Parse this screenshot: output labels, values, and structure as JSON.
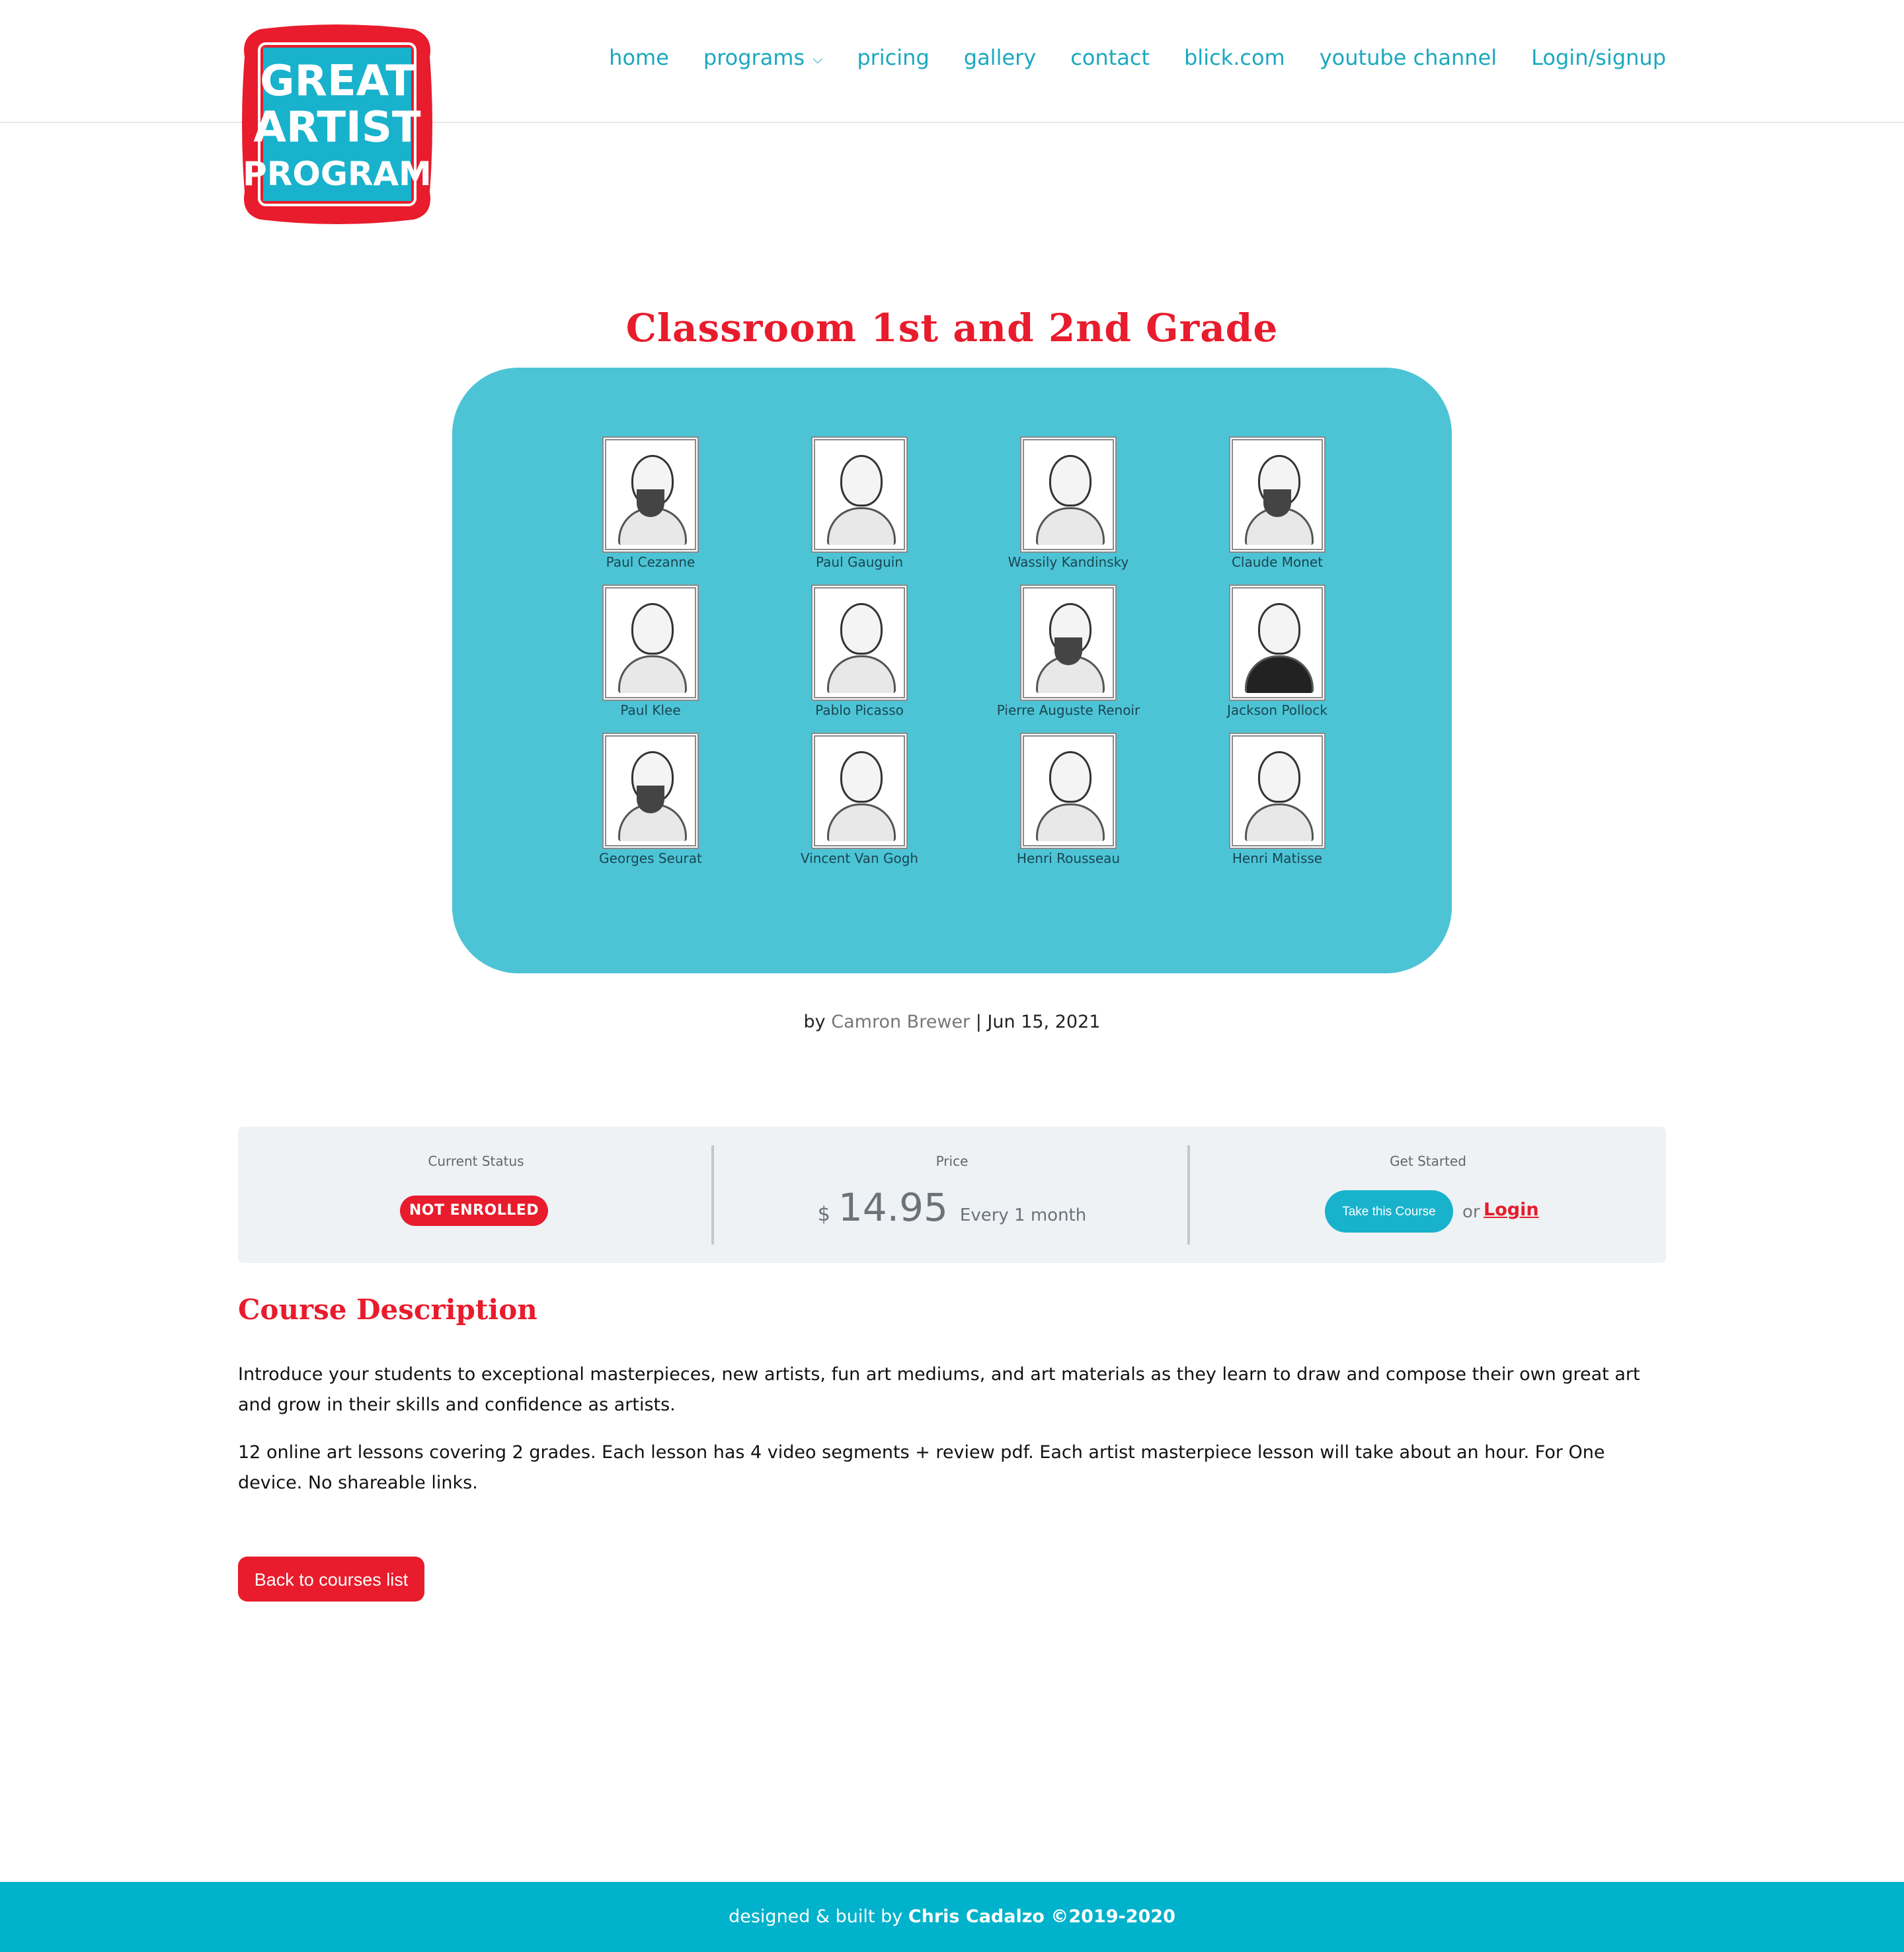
{
  "brand": {
    "logo_lines": [
      "GREAT",
      "ARTIST",
      "PROGRAM"
    ],
    "colors": {
      "red": "#e81c2c",
      "teal": "#18b2cc",
      "hero": "#4cc4d6"
    }
  },
  "nav": {
    "items": [
      {
        "label": "home"
      },
      {
        "label": "programs",
        "icon": "chevron-down-icon"
      },
      {
        "label": "pricing"
      },
      {
        "label": "gallery"
      },
      {
        "label": "contact"
      },
      {
        "label": "blick.com"
      },
      {
        "label": "youtube channel"
      },
      {
        "label": "Login/signup"
      }
    ]
  },
  "page": {
    "title": "Classroom 1st and 2nd Grade"
  },
  "hero": {
    "artists": [
      "Paul Cezanne",
      "Paul Gauguin",
      "Wassily Kandinsky",
      "Claude Monet",
      "Paul Klee",
      "Pablo Picasso",
      "Pierre Auguste Renoir",
      "Jackson Pollock",
      "Georges Seurat",
      "Vincent Van Gogh",
      "Henri Rousseau",
      "Henri Matisse"
    ]
  },
  "byline": {
    "prefix": "by",
    "author": "Camron Brewer",
    "separator": "|",
    "date": "Jun 15, 2021"
  },
  "status_panel": {
    "status_label": "Current Status",
    "status_value": "NOT ENROLLED",
    "price_label": "Price",
    "currency": "$",
    "price": "14.95",
    "period": "Every 1 month",
    "start_label": "Get Started",
    "take_button": "Take this Course",
    "or_text": "or",
    "login_link": "Login"
  },
  "description": {
    "heading": "Course Description",
    "paragraphs": [
      "Introduce your students to exceptional masterpieces, new artists, fun art mediums, and art materials as they learn to draw and compose their own great art and grow in their skills and confidence as artists.",
      "12 online art lessons covering 2 grades. Each lesson has 4 video segments + review pdf. Each artist masterpiece lesson will take about an hour. For One device. No shareable links."
    ],
    "back_button": "Back to courses list"
  },
  "footer": {
    "prefix": "designed & built by",
    "credit": "Chris Cadalzo ©2019-2020"
  }
}
